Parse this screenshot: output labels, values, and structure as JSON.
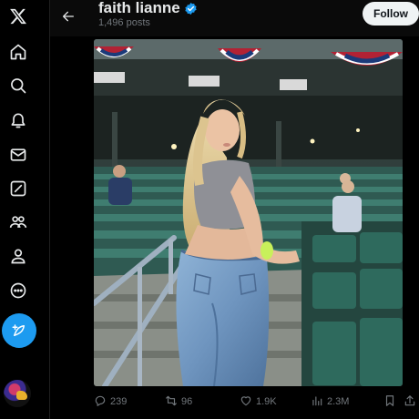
{
  "nav": {
    "items": [
      {
        "name": "x-logo"
      },
      {
        "name": "home"
      },
      {
        "name": "explore"
      },
      {
        "name": "notifications"
      },
      {
        "name": "messages"
      },
      {
        "name": "grok"
      },
      {
        "name": "communities"
      },
      {
        "name": "profile"
      },
      {
        "name": "more"
      }
    ],
    "compose": "post-compose"
  },
  "header": {
    "name": "faith lianne",
    "posts_count": "1,496 posts",
    "follow_label": "Follow"
  },
  "actions": {
    "replies": "239",
    "reposts": "96",
    "likes": "1.9K",
    "views": "2.3M"
  },
  "colors": {
    "accent": "#1d9bf0",
    "background": "#000000",
    "text_primary": "#e7e9ea",
    "text_secondary": "#71767b"
  }
}
